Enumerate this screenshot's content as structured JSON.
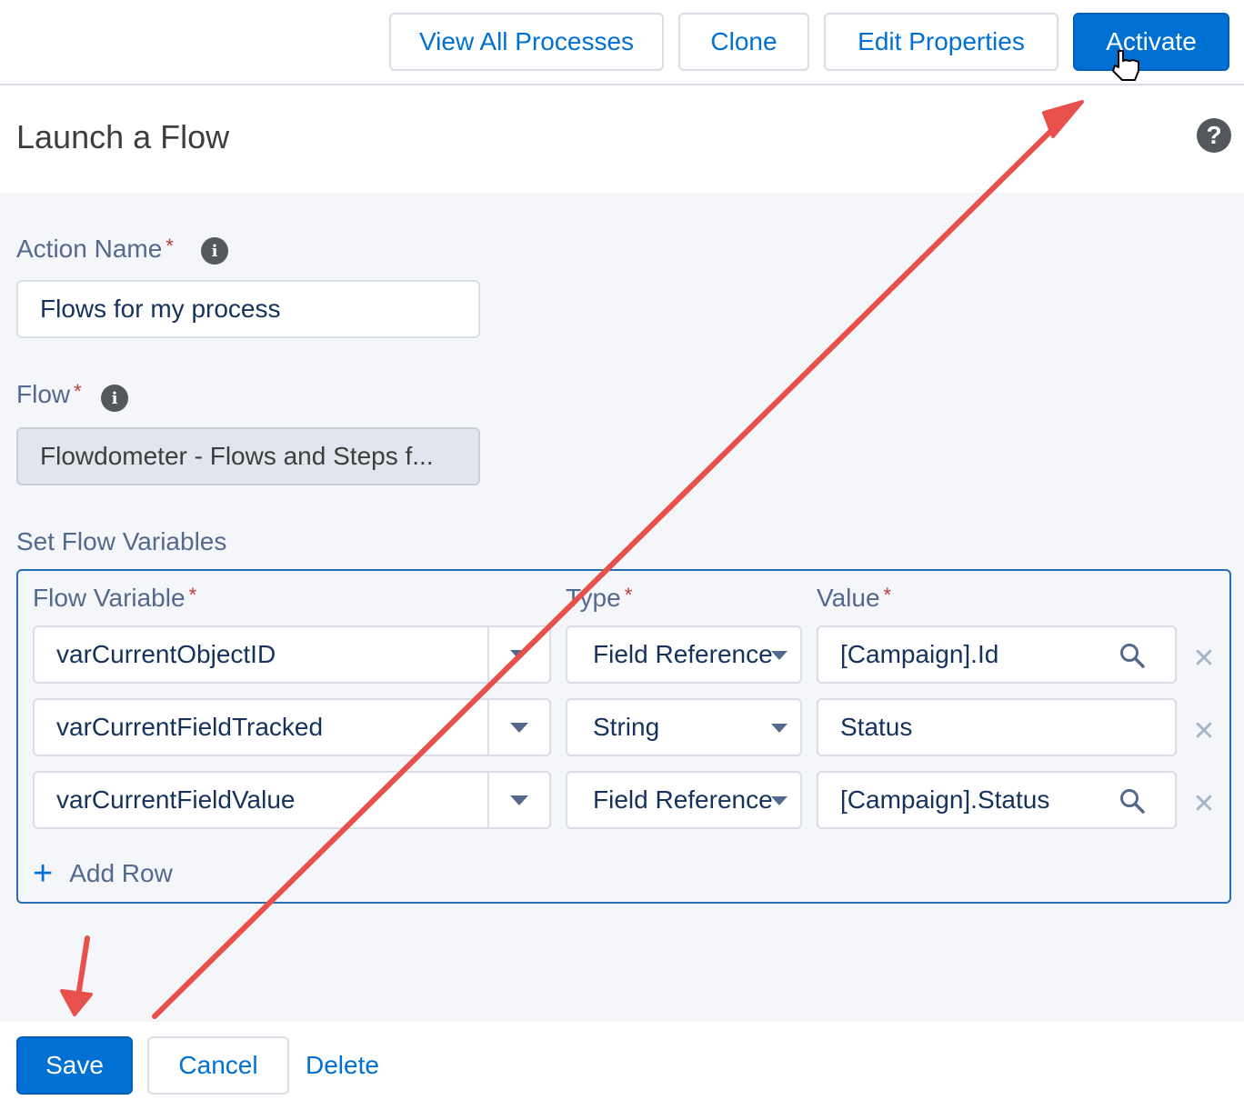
{
  "topbar": {
    "view_all_label": "View All Processes",
    "clone_label": "Clone",
    "edit_properties_label": "Edit Properties",
    "activate_label": "Activate"
  },
  "header": {
    "title": "Launch a Flow",
    "help_icon": "help-icon"
  },
  "form": {
    "action_name_label": "Action Name",
    "action_name_value": "Flows for my process",
    "flow_label": "Flow",
    "flow_value": "Flowdometer - Flows and Steps f...",
    "required_marker": "*",
    "info_icon_glyph": "i",
    "set_flow_variables_label": "Set Flow Variables"
  },
  "variables": {
    "columns": {
      "flow_variable": "Flow Variable",
      "type": "Type",
      "value": "Value"
    },
    "rows": [
      {
        "variable": "varCurrentObjectID",
        "type": "Field Reference",
        "value": "[Campaign].Id",
        "has_search": true
      },
      {
        "variable": "varCurrentFieldTracked",
        "type": "String",
        "value": "Status",
        "has_search": false
      },
      {
        "variable": "varCurrentFieldValue",
        "type": "Field Reference",
        "value": "[Campaign].Status",
        "has_search": true
      }
    ],
    "add_row_label": "Add Row",
    "remove_glyph": "✕",
    "plus_glyph": "+"
  },
  "footer": {
    "save_label": "Save",
    "cancel_label": "Cancel",
    "delete_label": "Delete"
  },
  "colors": {
    "brand": "#0070d2",
    "annotation_arrow": "#e8504b",
    "selected_border": "#2a6db0"
  }
}
